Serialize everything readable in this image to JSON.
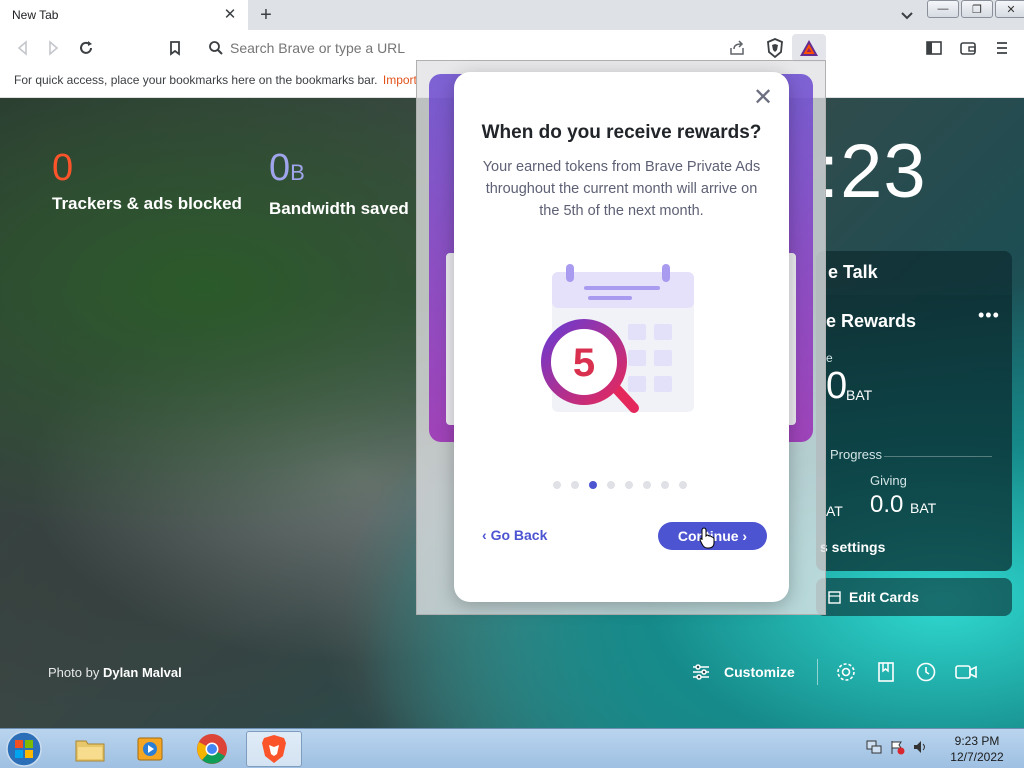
{
  "window": {
    "tab_title": "New Tab",
    "tab_close": "✕",
    "new_tab": "+",
    "controls": [
      "—",
      "❐",
      "✕"
    ]
  },
  "toolbar": {
    "search_placeholder": "Search Brave or type a URL"
  },
  "bookmarks_bar": {
    "message": "For quick access, place your bookmarks here on the bookmarks bar.",
    "import_label": "Import"
  },
  "ntp": {
    "trackers_value": "0",
    "trackers_label": "Trackers & ads blocked",
    "bandwidth_value": "0",
    "bandwidth_unit": "B",
    "bandwidth_label": "Bandwidth saved",
    "clock": ":23",
    "talk_card_title": "e Talk",
    "rewards_card_title": "e Rewards",
    "rewards_menu": "•••",
    "balance_label": "e",
    "balance_value": "0",
    "balance_unit": "BAT",
    "progress_label": "Progress",
    "left_bat": "AT",
    "giving_label": "Giving",
    "giving_value": "0.0",
    "giving_unit": "BAT",
    "settings_link": "s settings",
    "edit_cards": "Edit Cards",
    "photo_prefix": "Photo by",
    "photo_author": "Dylan Malval",
    "customize": "Customize"
  },
  "modal": {
    "heading": "When do you receive rewards?",
    "body": "Your earned tokens from Brave Private Ads throughout the current month will arrive on the 5th of the next month.",
    "illustration_number": "5",
    "close": "✕",
    "dots_total": 8,
    "dots_active_index": 2,
    "back_label": "Go Back",
    "continue_label": "Continue"
  },
  "taskbar": {
    "time": "9:23 PM",
    "date": "12/7/2022"
  },
  "colors": {
    "brand_orange": "#fb542b",
    "accent_blue": "#4c54d2",
    "bandwidth_purple": "#a0a5eb"
  }
}
